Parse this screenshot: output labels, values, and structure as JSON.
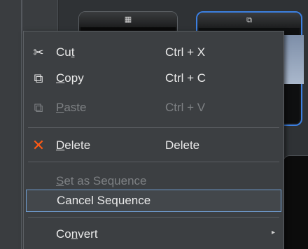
{
  "background": {
    "clip_a_icon": "film-strip-icon",
    "clip_b_icon": "sequence-icon",
    "accent_color": "#3c7fe0"
  },
  "menu": {
    "items": [
      {
        "id": "cut",
        "pre": "Cu",
        "mnemonic": "t",
        "post": "",
        "shortcut": "Ctrl + X",
        "icon": "scissors-icon",
        "enabled": true
      },
      {
        "id": "copy",
        "pre": "",
        "mnemonic": "C",
        "post": "opy",
        "shortcut": "Ctrl + C",
        "icon": "copy-icon",
        "enabled": true
      },
      {
        "id": "paste",
        "pre": "",
        "mnemonic": "P",
        "post": "aste",
        "shortcut": "Ctrl + V",
        "icon": "paste-icon",
        "enabled": false
      },
      {
        "id": "delete",
        "pre": "",
        "mnemonic": "D",
        "post": "elete",
        "shortcut": "Delete",
        "icon": "delete-x-icon",
        "enabled": true,
        "icon_color": "#ff5a14"
      },
      {
        "id": "set-as-sequence",
        "pre": "",
        "mnemonic": "S",
        "post": "et as Sequence",
        "shortcut": "",
        "enabled": false
      },
      {
        "id": "cancel-sequence",
        "pre": "",
        "mnemonic": "",
        "post": "Cancel Sequence",
        "shortcut": "",
        "enabled": true,
        "highlighted": true
      },
      {
        "id": "convert",
        "pre": "Co",
        "mnemonic": "n",
        "post": "vert",
        "shortcut": "",
        "enabled": true,
        "submenu": true
      }
    ]
  }
}
